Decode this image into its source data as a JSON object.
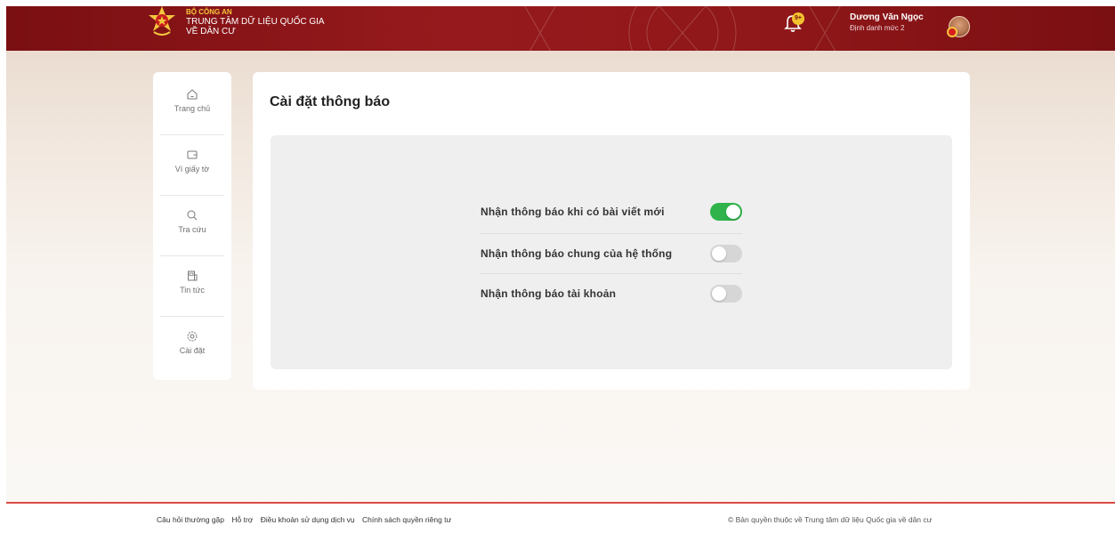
{
  "header": {
    "org_line1": "BỘ CÔNG AN",
    "org_line2": "TRUNG TÂM DỮ LIỆU QUỐC GIA",
    "org_line3": "VỀ DÂN CƯ",
    "notification_badge": "9+",
    "user_name": "Dương Văn Ngọc",
    "user_level": "Định danh mức 2"
  },
  "sidebar": {
    "items": [
      {
        "label": "Trang chủ",
        "icon": "home-icon"
      },
      {
        "label": "Ví giấy tờ",
        "icon": "wallet-icon"
      },
      {
        "label": "Tra cứu",
        "icon": "search-icon"
      },
      {
        "label": "Tin tức",
        "icon": "news-icon"
      },
      {
        "label": "Cài đặt",
        "icon": "gear-icon"
      }
    ]
  },
  "main": {
    "title": "Cài đặt thông báo",
    "settings": [
      {
        "label": "Nhận thông báo khi có bài viết mới",
        "enabled": true
      },
      {
        "label": "Nhận thông báo chung của hệ thống",
        "enabled": false
      },
      {
        "label": "Nhận thông báo tài khoản",
        "enabled": false
      }
    ]
  },
  "footer": {
    "links": [
      "Câu hỏi thường gặp",
      "Hỗ trợ",
      "Điều khoản sử dụng dịch vụ",
      "Chính sách quyền riêng tư"
    ],
    "copyright": "© Bản quyền thuộc về Trung tâm dữ liệu Quốc gia về dân cư"
  },
  "colors": {
    "brand": "#8f1719",
    "toggle_on": "#2fb34a",
    "toggle_off": "#d6d6d6",
    "accent_gold": "#f4c63d"
  }
}
